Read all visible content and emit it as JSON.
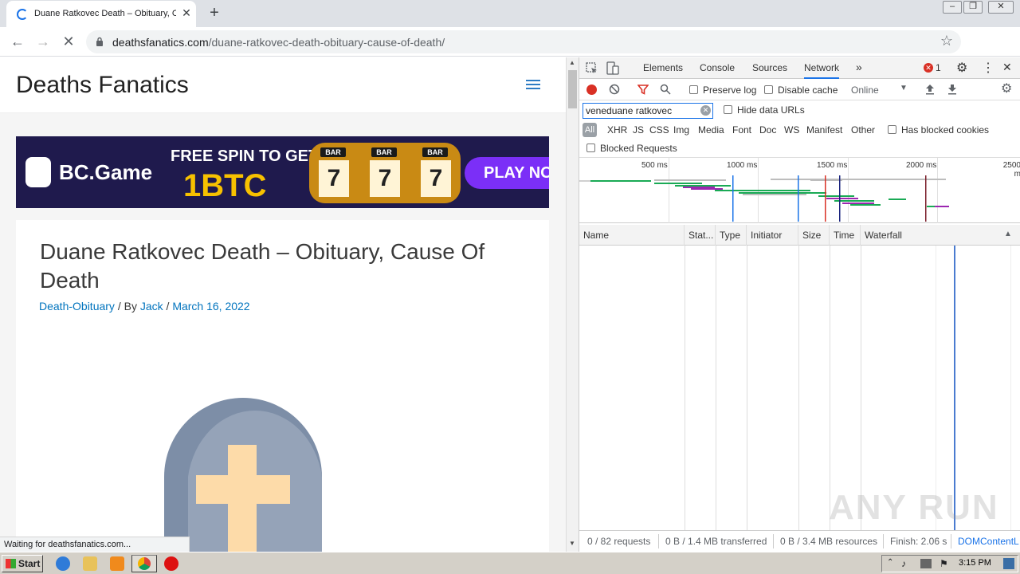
{
  "browser": {
    "tab_title": "Duane Ratkovec Death – Obituary, C",
    "tab_close": "✕",
    "new_tab": "+",
    "url_host": "deathsfanatics.com",
    "url_path": "/duane-ratkovec-death-obituary-cause-of-death/",
    "status": "Waiting for deathsfanatics.com..."
  },
  "site": {
    "title": "Deaths Fanatics",
    "banner": {
      "brand": "BC.Game",
      "promo_line1": "FREE SPIN TO GET",
      "promo_line2": "1BTC",
      "reel": "7",
      "bar": "BAR",
      "play": "PLAY NO"
    },
    "post": {
      "title": "Duane Ratkovec Death – Obituary, Cause Of Death",
      "category": "Death-Obituary",
      "by": " / By ",
      "author": "Jack",
      "sep": " / ",
      "date": "March 16, 2022"
    }
  },
  "devtools": {
    "tabs": [
      "Elements",
      "Console",
      "Sources",
      "Network"
    ],
    "more": "»",
    "error_count": "1",
    "toolbar": {
      "preserve_log": "Preserve log",
      "disable_cache": "Disable cache",
      "throttle": "Online"
    },
    "filter": {
      "value": "veneduane ratkovec",
      "hide_data_urls": "Hide data URLs",
      "types": [
        "All",
        "XHR",
        "JS",
        "CSS",
        "Img",
        "Media",
        "Font",
        "Doc",
        "WS",
        "Manifest",
        "Other"
      ],
      "has_blocked_cookies": "Has blocked cookies",
      "blocked_requests": "Blocked Requests"
    },
    "overview_ticks": [
      "500 ms",
      "1000 ms",
      "1500 ms",
      "2000 ms",
      "2500 m"
    ],
    "columns": [
      "Name",
      "Stat...",
      "Type",
      "Initiator",
      "Size",
      "Time",
      "Waterfall"
    ],
    "status": {
      "requests": "0 / 82 requests",
      "transferred": "0 B / 1.4 MB transferred",
      "resources": "0 B / 3.4 MB resources",
      "finish": "Finish: 2.06 s",
      "domcontent": "DOMContentL"
    },
    "watermark": "ANY RUN"
  },
  "taskbar": {
    "start": "Start",
    "clock": "3:15 PM"
  }
}
